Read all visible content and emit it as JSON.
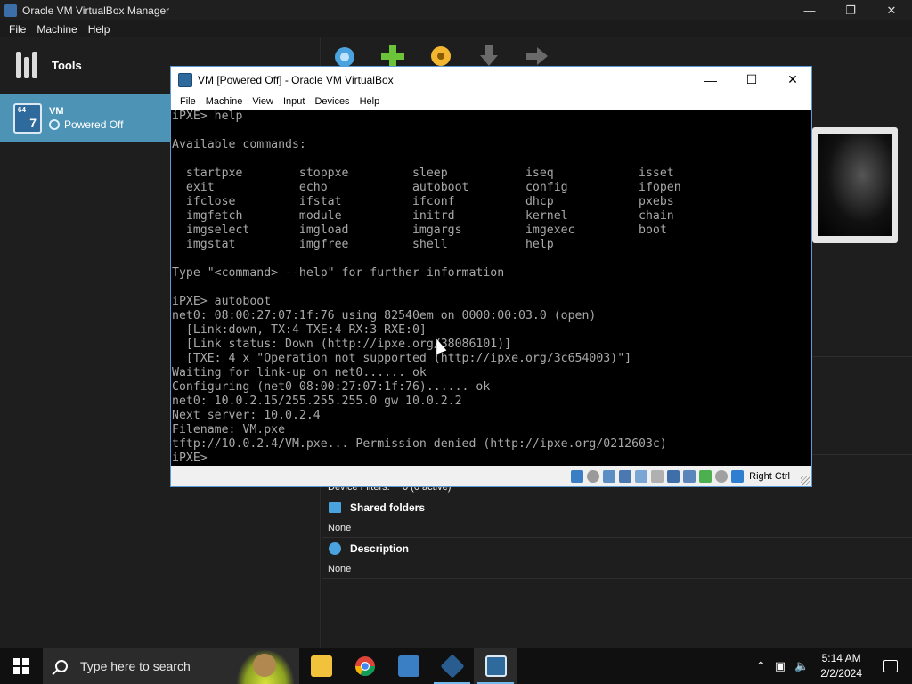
{
  "manager": {
    "title": "Oracle VM VirtualBox Manager",
    "menu": [
      "File",
      "Machine",
      "Help"
    ],
    "tools_label": "Tools",
    "vm": {
      "name": "VM",
      "status": "Powered Off"
    },
    "details": {
      "device_filters_label": "Device Filters:",
      "device_filters_value": "0 (0 active)",
      "shared_folders_title": "Shared folders",
      "shared_folders_value": "None",
      "description_title": "Description",
      "description_value": "None"
    }
  },
  "vm_window": {
    "title": "VM [Powered Off] - Oracle VM VirtualBox",
    "menu": [
      "File",
      "Machine",
      "View",
      "Input",
      "Devices",
      "Help"
    ],
    "host_key": "Right Ctrl",
    "console_lines": [
      "iPXE> help",
      "",
      "Available commands:",
      "",
      "  startpxe        stoppxe         sleep           iseq            isset",
      "  exit            echo            autoboot        config          ifopen",
      "  ifclose         ifstat          ifconf          dhcp            pxebs",
      "  imgfetch        module          initrd          kernel          chain",
      "  imgselect       imgload         imgargs         imgexec         boot",
      "  imgstat         imgfree         shell           help",
      "",
      "Type \"<command> --help\" for further information",
      "",
      "iPXE> autoboot",
      "net0: 08:00:27:07:1f:76 using 82540em on 0000:00:03.0 (open)",
      "  [Link:down, TX:4 TXE:4 RX:3 RXE:0]",
      "  [Link status: Down (http://ipxe.org/38086101)]",
      "  [TXE: 4 x \"Operation not supported (http://ipxe.org/3c654003)\"]",
      "Waiting for link-up on net0...... ok",
      "Configuring (net0 08:00:27:07:1f:76)...... ok",
      "net0: 10.0.2.15/255.255.255.0 gw 10.0.2.2",
      "Next server: 10.0.2.4",
      "Filename: VM.pxe",
      "tftp://10.0.2.4/VM.pxe... Permission denied (http://ipxe.org/0212603c)",
      "iPXE>"
    ]
  },
  "taskbar": {
    "search_placeholder": "Type here to search",
    "time": "5:14 AM",
    "date": "2/2/2024"
  },
  "colors": {
    "vm_selected": "#4d93b5",
    "accent": "#4aa3df",
    "console_text": "#a8a8a8"
  }
}
